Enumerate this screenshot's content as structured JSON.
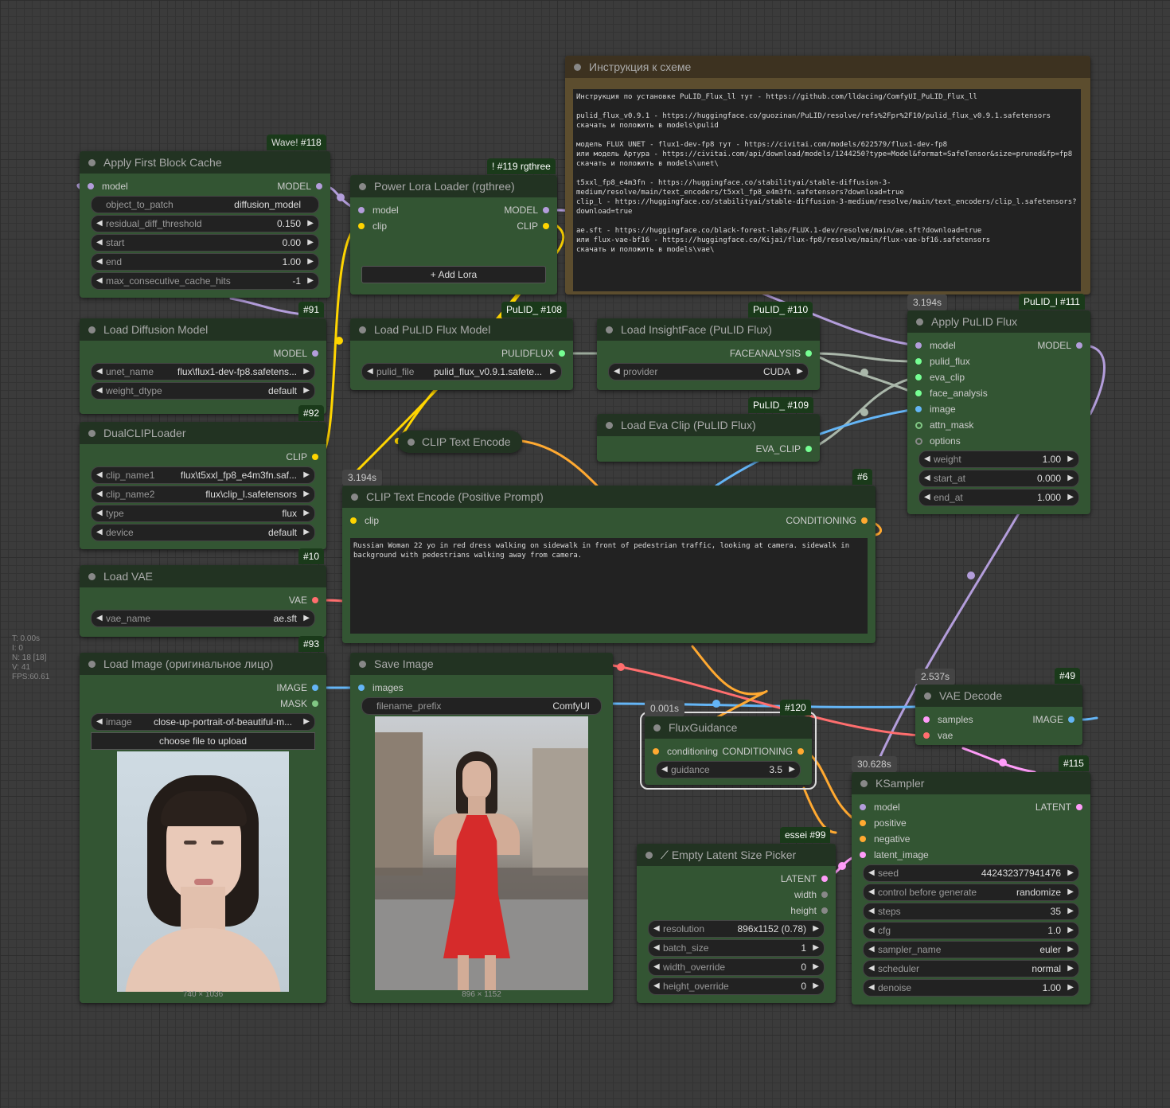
{
  "stats": {
    "time": "T: 0.00s",
    "i": "I: 0",
    "n": "N: 18 [18]",
    "v": "V: 41",
    "fps": "FPS:60.61"
  },
  "notes": {
    "title": "Инструкция к схеме",
    "text": "Инструкция по установке PuLID_Flux_ll тут - https://github.com/lldacing/ComfyUI_PuLID_Flux_ll\n\npulid_flux_v0.9.1 - https://huggingface.co/guozinan/PuLID/resolve/refs%2Fpr%2F10/pulid_flux_v0.9.1.safetensors\nскачать и положить в models\\pulid\n\nмодель FLUX UNET - flux1-dev-fp8 тут - https://civitai.com/models/622579/flux1-dev-fp8\nили модель Артура - https://civitai.com/api/download/models/1244250?type=Model&format=SafeTensor&size=pruned&fp=fp8\nскачать и положить в models\\unet\\\n\nt5xxl_fp8_e4m3fn - https://huggingface.co/stabilityai/stable-diffusion-3-medium/resolve/main/text_encoders/t5xxl_fp8_e4m3fn.safetensors?download=true\nclip_l - https://huggingface.co/stabilityai/stable-diffusion-3-medium/resolve/main/text_encoders/clip_l.safetensors?download=true\n\nae.sft - https://huggingface.co/black-forest-labs/FLUX.1-dev/resolve/main/ae.sft?download=true\nили flux-vae-bf16 - https://huggingface.co/Kijai/flux-fp8/resolve/main/flux-vae-bf16.safetensors\nскачать и положить в models\\vae\\"
  },
  "colors": {
    "model": "#b39ddb",
    "clip": "#ffd500",
    "vae": "#ff6e6e",
    "image": "#64b5f6",
    "mask": "#81c784",
    "latent": "#ff9cf9",
    "conditioning": "#ffa931",
    "pulid": "#76ff93",
    "other": "#888888"
  },
  "n118": {
    "title": "Apply First Block Cache",
    "badge_tag": "Wave!",
    "badge_id": "#118",
    "in_model": "model",
    "out_model": "MODEL",
    "object_to_patch_label": "object_to_patch",
    "object_to_patch_value": "diffusion_model",
    "residual_label": "residual_diff_threshold",
    "residual_value": "0.150",
    "start_label": "start",
    "start_value": "0.00",
    "end_label": "end",
    "end_value": "1.00",
    "max_label": "max_consecutive_cache_hits",
    "max_value": "-1"
  },
  "n119": {
    "title": "Power Lora Loader (rgthree)",
    "badge_tag": "!",
    "badge_id": "#119 rgthree",
    "in_model": "model",
    "in_clip": "clip",
    "out_model": "MODEL",
    "out_clip": "CLIP",
    "add_lora": "Add Lora"
  },
  "n91": {
    "title": "Load Diffusion Model",
    "badge_id": "#91",
    "out_model": "MODEL",
    "unet_label": "unet_name",
    "unet_value": "flux\\flux1-dev-fp8.safetens...",
    "dtype_label": "weight_dtype",
    "dtype_value": "default"
  },
  "n92": {
    "title": "DualCLIPLoader",
    "badge_id": "#92",
    "out_clip": "CLIP",
    "clip1_label": "clip_name1",
    "clip1_value": "flux\\t5xxl_fp8_e4m3fn.saf...",
    "clip2_label": "clip_name2",
    "clip2_value": "flux\\clip_l.safetensors",
    "type_label": "type",
    "type_value": "flux",
    "device_label": "device",
    "device_value": "default"
  },
  "n10": {
    "title": "Load VAE",
    "badge_id": "#10",
    "out_vae": "VAE",
    "vae_label": "vae_name",
    "vae_value": "ae.sft"
  },
  "n93": {
    "title": "Load Image (оригинальное лицо)",
    "badge_id": "#93",
    "out_image": "IMAGE",
    "out_mask": "MASK",
    "image_label": "image",
    "image_value": "close-up-portrait-of-beautiful-m...",
    "upload": "choose file to upload",
    "size": "740 × 1036"
  },
  "n108": {
    "title": "Load PuLID Flux Model",
    "badge_tag": "PuLID_",
    "badge_id": "#108",
    "out": "PULIDFLUX",
    "file_label": "pulid_file",
    "file_value": "pulid_flux_v0.9.1.safete..."
  },
  "n110": {
    "title": "Load InsightFace (PuLID Flux)",
    "badge_tag": "PuLID_",
    "badge_id": "#110",
    "out": "FACEANALYSIS",
    "provider_label": "provider",
    "provider_value": "CUDA"
  },
  "n109": {
    "title": "Load Eva Clip (PuLID Flux)",
    "badge_tag": "PuLID_",
    "badge_id": "#109",
    "out": "EVA_CLIP"
  },
  "n111": {
    "title": "Apply PuLID Flux",
    "badge_tag": "PuLID_l",
    "badge_id": "#111",
    "timing": "3.194s",
    "in_model": "model",
    "in_pulid": "pulid_flux",
    "in_eva": "eva_clip",
    "in_face": "face_analysis",
    "in_image": "image",
    "in_attn": "attn_mask",
    "in_options": "options",
    "out_model": "MODEL",
    "weight_label": "weight",
    "weight_value": "1.00",
    "start_label": "start_at",
    "start_value": "0.000",
    "end_label": "end_at",
    "end_value": "1.000"
  },
  "nclip": {
    "title": "CLIP Text Encode"
  },
  "n6": {
    "title": "CLIP Text Encode (Positive Prompt)",
    "badge_id": "#6",
    "timing": "3.194s",
    "in_clip": "clip",
    "out": "CONDITIONING",
    "text": "Russian Woman 22 yo in red dress walking on sidewalk in front of pedestrian traffic, looking at camera. sidewalk in background with pedestrians walking away from camera."
  },
  "nsave": {
    "title": "Save Image",
    "in_images": "images",
    "prefix_label": "filename_prefix",
    "prefix_value": "ComfyUI",
    "size": "896 × 1152"
  },
  "n120": {
    "title": "FluxGuidance",
    "badge_id": "#120",
    "timing": "0.001s",
    "in": "conditioning",
    "out": "CONDITIONING",
    "guidance_label": "guidance",
    "guidance_value": "3.5"
  },
  "n49": {
    "title": "VAE Decode",
    "badge_id": "#49",
    "timing": "2.537s",
    "in_samples": "samples",
    "in_vae": "vae",
    "out": "IMAGE"
  },
  "n99": {
    "title": "Empty Latent Size Picker",
    "badge_tag": "essei",
    "badge_id": "#99",
    "out_latent": "LATENT",
    "out_width": "width",
    "out_height": "height",
    "res_label": "resolution",
    "res_value": "896x1152 (0.78)",
    "batch_label": "batch_size",
    "batch_value": "1",
    "wo_label": "width_override",
    "wo_value": "0",
    "ho_label": "height_override",
    "ho_value": "0"
  },
  "n115": {
    "title": "KSampler",
    "badge_id": "#115",
    "timing": "30.628s",
    "in_model": "model",
    "in_pos": "positive",
    "in_neg": "negative",
    "in_latent": "latent_image",
    "out": "LATENT",
    "seed_label": "seed",
    "seed_value": "442432377941476",
    "cbg_label": "control before generate",
    "cbg_value": "randomize",
    "steps_label": "steps",
    "steps_value": "35",
    "cfg_label": "cfg",
    "cfg_value": "1.0",
    "sampler_label": "sampler_name",
    "sampler_value": "euler",
    "scheduler_label": "scheduler",
    "scheduler_value": "normal",
    "denoise_label": "denoise",
    "denoise_value": "1.00"
  }
}
